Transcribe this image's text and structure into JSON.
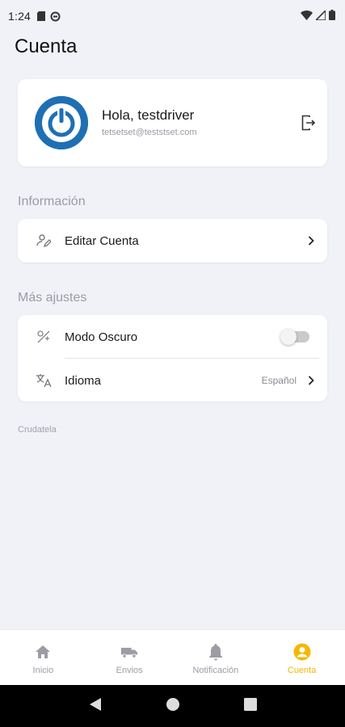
{
  "status_bar": {
    "time": "1:24"
  },
  "page": {
    "title": "Cuenta"
  },
  "profile": {
    "greeting": "Hola, testdriver",
    "email": "tetsetset@teststset.com"
  },
  "sections": {
    "info_label": "Información",
    "more_label": "Más ajustes"
  },
  "rows": {
    "edit_account": "Editar Cuenta",
    "dark_mode": "Modo Oscuro",
    "dark_mode_enabled": false,
    "language": "Idioma",
    "language_value": "Español"
  },
  "footer_note": "Crudatela",
  "tabs": [
    {
      "label": "Inicio",
      "icon": "home-icon",
      "active": false
    },
    {
      "label": "Envios",
      "icon": "truck-icon",
      "active": false
    },
    {
      "label": "Notificación",
      "icon": "bell-icon",
      "active": false
    },
    {
      "label": "Cuenta",
      "icon": "account-icon",
      "active": true
    }
  ],
  "colors": {
    "accent": "#f5b800",
    "avatar": "#1f6fb5",
    "background": "#f1f2f8"
  }
}
